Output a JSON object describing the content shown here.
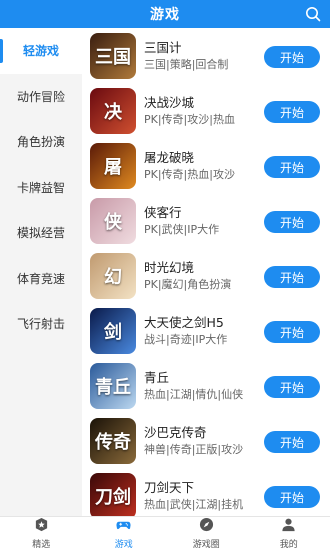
{
  "header": {
    "title": "游戏",
    "search_icon": "search-icon"
  },
  "categories": [
    {
      "label": "轻游戏",
      "active": true
    },
    {
      "label": "动作冒险"
    },
    {
      "label": "角色扮演"
    },
    {
      "label": "卡牌益智"
    },
    {
      "label": "模拟经营"
    },
    {
      "label": "体育竞速"
    },
    {
      "label": "飞行射击"
    }
  ],
  "games": [
    {
      "name": "三国计",
      "tags": "三国|策略|回合制",
      "icon_text": "三国",
      "colors": [
        "#3a1e10",
        "#b07a3a"
      ],
      "button": "开始"
    },
    {
      "name": "决战沙城",
      "tags": "PK|传奇|攻沙|热血",
      "icon_text": "决",
      "colors": [
        "#6a0a10",
        "#d05030"
      ],
      "button": "开始"
    },
    {
      "name": "屠龙破晓",
      "tags": "PK|传奇|热血|攻沙",
      "icon_text": "屠",
      "colors": [
        "#5a1a08",
        "#e08a20"
      ],
      "button": "开始"
    },
    {
      "name": "侠客行",
      "tags": "PK|武侠|IP大作",
      "icon_text": "侠",
      "colors": [
        "#c89aa8",
        "#f0dce0"
      ],
      "button": "开始"
    },
    {
      "name": "时光幻境",
      "tags": "PK|魔幻|角色扮演",
      "icon_text": "幻",
      "colors": [
        "#c09a70",
        "#f3e2c4"
      ],
      "button": "开始"
    },
    {
      "name": "大天使之剑H5",
      "tags": "战斗|奇迹|IP大作",
      "icon_text": "剑",
      "colors": [
        "#0a1a4a",
        "#4a8ae0"
      ],
      "button": "开始"
    },
    {
      "name": "青丘",
      "tags": "热血|江湖|情仇|仙侠",
      "icon_text": "青丘",
      "colors": [
        "#2a5a9a",
        "#bcd8f0"
      ],
      "button": "开始"
    },
    {
      "name": "沙巴克传奇",
      "tags": "神兽|传奇|正版|攻沙",
      "icon_text": "传奇",
      "colors": [
        "#1a1208",
        "#8a6a3a"
      ],
      "button": "开始"
    },
    {
      "name": "刀剑天下",
      "tags": "热血|武侠|江湖|挂机",
      "icon_text": "刀剑",
      "colors": [
        "#3a0808",
        "#c03020"
      ],
      "button": "开始"
    }
  ],
  "tabbar": [
    {
      "label": "精选",
      "icon": "star-badge-icon",
      "active": false
    },
    {
      "label": "游戏",
      "icon": "gamepad-icon",
      "active": true
    },
    {
      "label": "游戏圈",
      "icon": "compass-icon",
      "active": false
    },
    {
      "label": "我的",
      "icon": "user-icon",
      "active": false
    }
  ],
  "colors": {
    "accent": "#1e8cf0",
    "sidebar_bg": "#f4f4f4",
    "text": "#222222",
    "subtext": "#666666"
  }
}
